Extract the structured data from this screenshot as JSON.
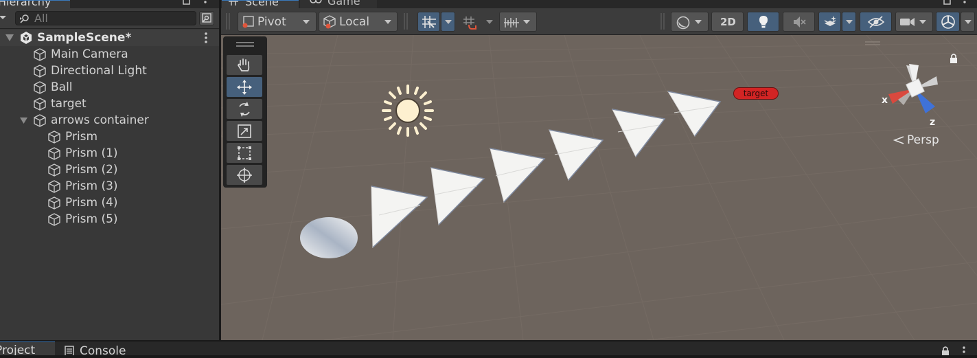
{
  "hierarchy": {
    "tab_label": "Hierarchy",
    "search_placeholder": "All",
    "scene_name": "SampleScene*",
    "items": [
      {
        "label": "Main Camera"
      },
      {
        "label": "Directional Light"
      },
      {
        "label": "Ball"
      },
      {
        "label": "target"
      },
      {
        "label": "arrows container"
      },
      {
        "label": "Prism"
      },
      {
        "label": "Prism (1)"
      },
      {
        "label": "Prism (2)"
      },
      {
        "label": "Prism (3)"
      },
      {
        "label": "Prism (4)"
      },
      {
        "label": "Prism (5)"
      }
    ]
  },
  "scene": {
    "tab_scene": "Scene",
    "tab_game": "Game",
    "pivot_label": "Pivot",
    "local_label": "Local",
    "mode_2d": "2D",
    "persp_label": "Persp",
    "axis_x": "x",
    "axis_z": "z",
    "target_label": "target"
  },
  "bottom": {
    "tab_project": "Project",
    "tab_console": "Console"
  },
  "colors": {
    "accent": "#3a79bb",
    "selected_button": "#46607c",
    "target_red": "#d22424",
    "viewport_bg": "#6d645d"
  }
}
